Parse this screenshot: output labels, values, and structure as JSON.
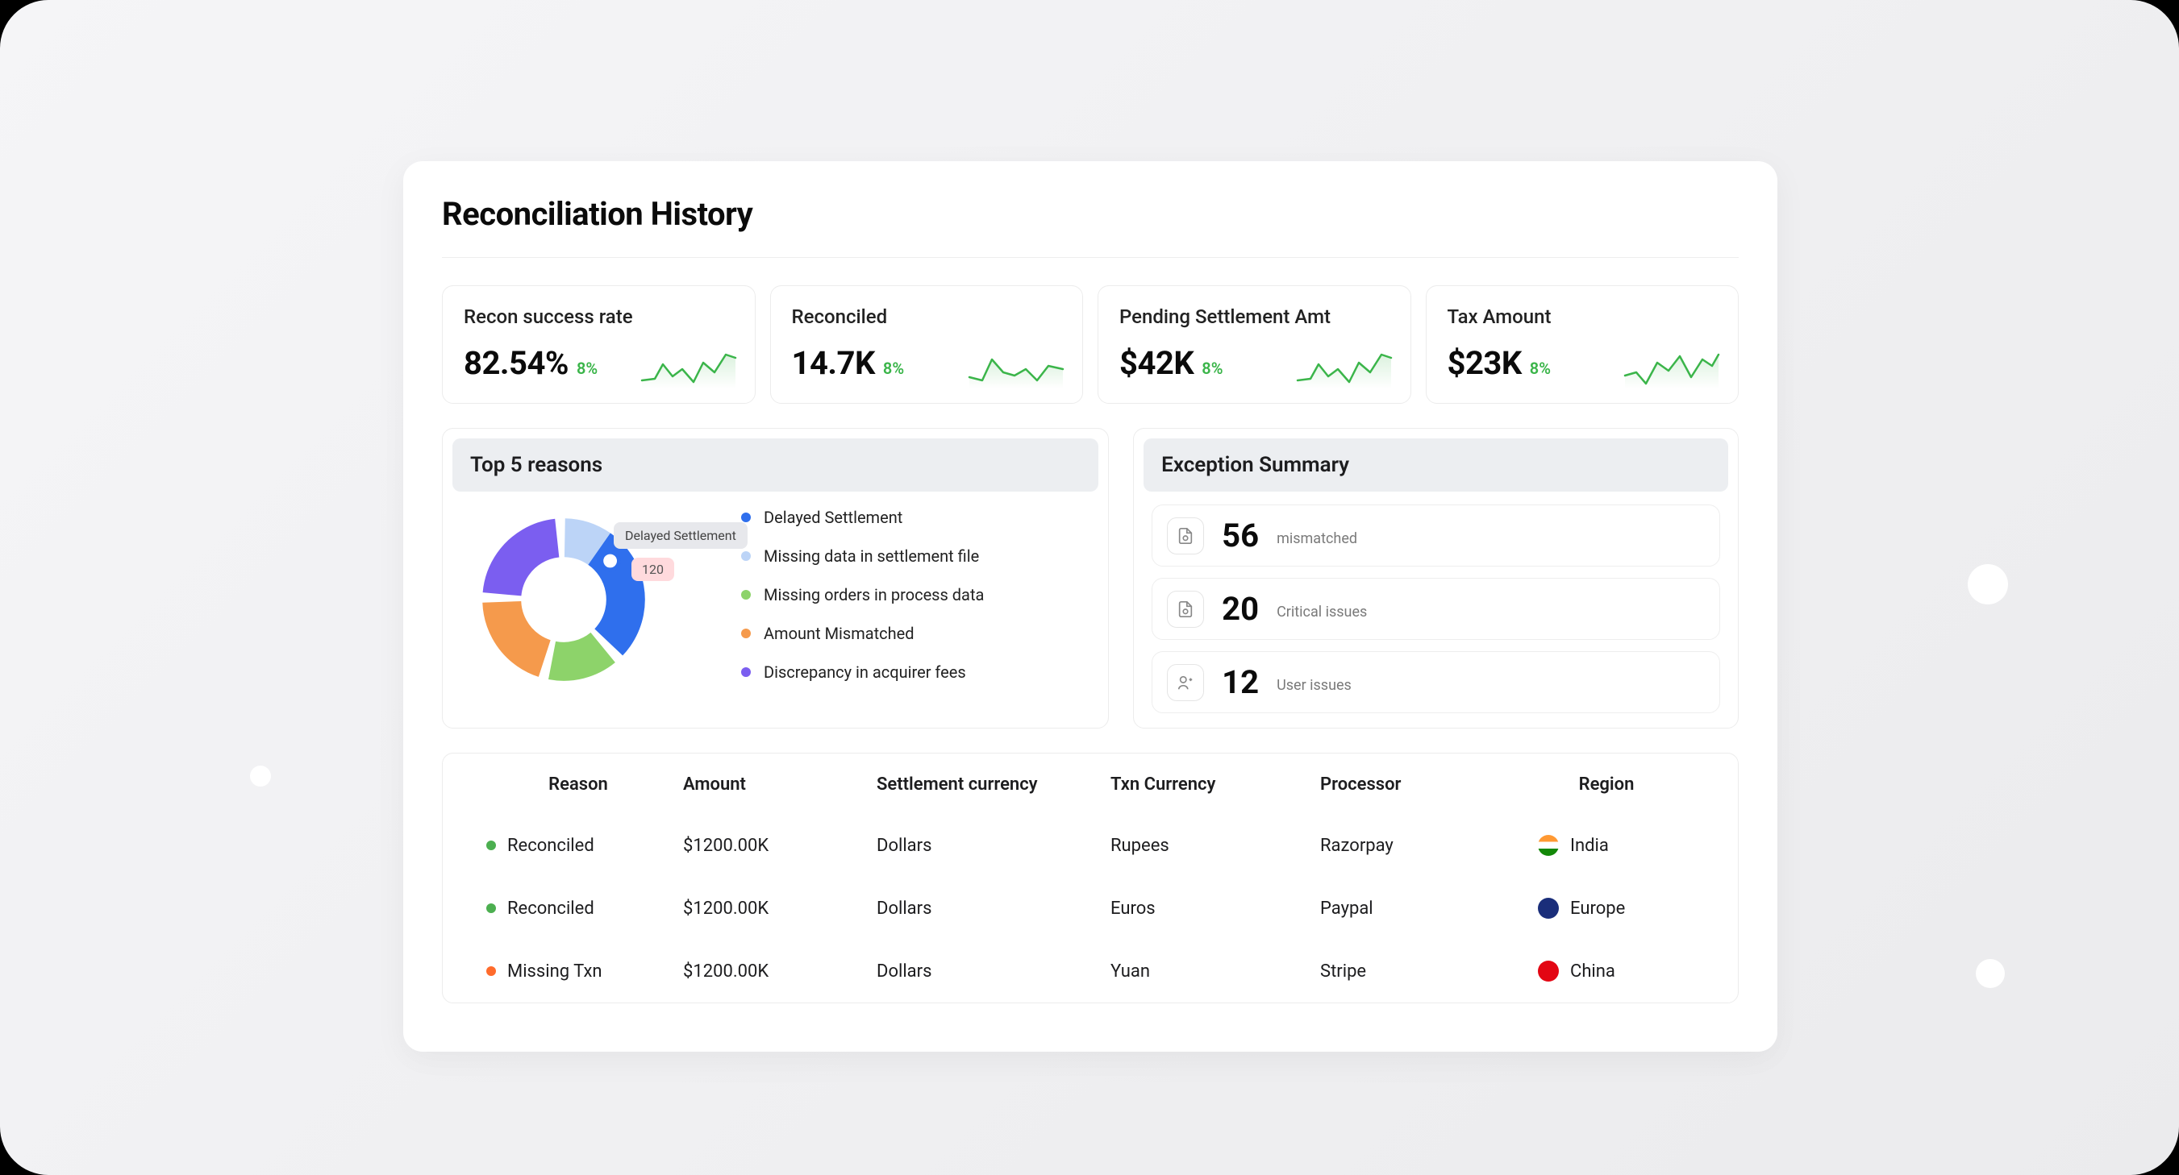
{
  "title": "Reconciliation History",
  "metrics": [
    {
      "label": "Recon success rate",
      "value": "82.54%",
      "delta": "8%"
    },
    {
      "label": "Reconciled",
      "value": "14.7K",
      "delta": "8%"
    },
    {
      "label": "Pending Settlement Amt",
      "value": "$42K",
      "delta": "8%"
    },
    {
      "label": "Tax Amount",
      "value": "$23K",
      "delta": "8%"
    }
  ],
  "top5": {
    "title": "Top 5 reasons",
    "tooltip_label": "Delayed Settlement",
    "tooltip_value": "120",
    "items": [
      {
        "label": "Delayed Settlement",
        "color": "#2f6fed"
      },
      {
        "label": "Missing data in settlement file",
        "color": "#bcd4f7"
      },
      {
        "label": "Missing orders in process data",
        "color": "#8dd36a"
      },
      {
        "label": "Amount Mismatched",
        "color": "#f59a4c"
      },
      {
        "label": "Discrepancy in acquirer fees",
        "color": "#7b5ef0"
      }
    ]
  },
  "exception": {
    "title": "Exception Summary",
    "items": [
      {
        "num": "56",
        "label": "mismatched",
        "icon": "doc"
      },
      {
        "num": "20",
        "label": "Critical issues",
        "icon": "doc"
      },
      {
        "num": "12",
        "label": "User issues",
        "icon": "user"
      }
    ]
  },
  "table": {
    "headers": [
      "Reason",
      "Amount",
      "Settlement currency",
      "Txn Currency",
      "Processor",
      "Region"
    ],
    "rows": [
      {
        "status_color": "#4caf50",
        "reason": "Reconciled",
        "amount": "$1200.00K",
        "settle": "Dollars",
        "txn": "Rupees",
        "proc": "Razorpay",
        "flag": "india",
        "region": "India"
      },
      {
        "status_color": "#4caf50",
        "reason": "Reconciled",
        "amount": "$1200.00K",
        "settle": "Dollars",
        "txn": "Euros",
        "proc": "Paypal",
        "flag": "europe",
        "region": "Europe"
      },
      {
        "status_color": "#ff6b2c",
        "reason": "Missing Txn",
        "amount": "$1200.00K",
        "settle": "Dollars",
        "txn": "Yuan",
        "proc": "Stripe",
        "flag": "china",
        "region": "China"
      }
    ]
  },
  "chart_data": {
    "type": "pie",
    "title": "Top 5 reasons",
    "series": [
      {
        "name": "Delayed Settlement",
        "value": 120,
        "color": "#2f6fed"
      },
      {
        "name": "Missing data in settlement file",
        "value": 75,
        "color": "#bcd4f7"
      },
      {
        "name": "Discrepancy in acquirer fees",
        "value": 95,
        "color": "#7b5ef0"
      },
      {
        "name": "Amount Mismatched",
        "value": 85,
        "color": "#f59a4c"
      },
      {
        "name": "Missing orders in process data",
        "value": 60,
        "color": "#8dd36a"
      }
    ]
  }
}
